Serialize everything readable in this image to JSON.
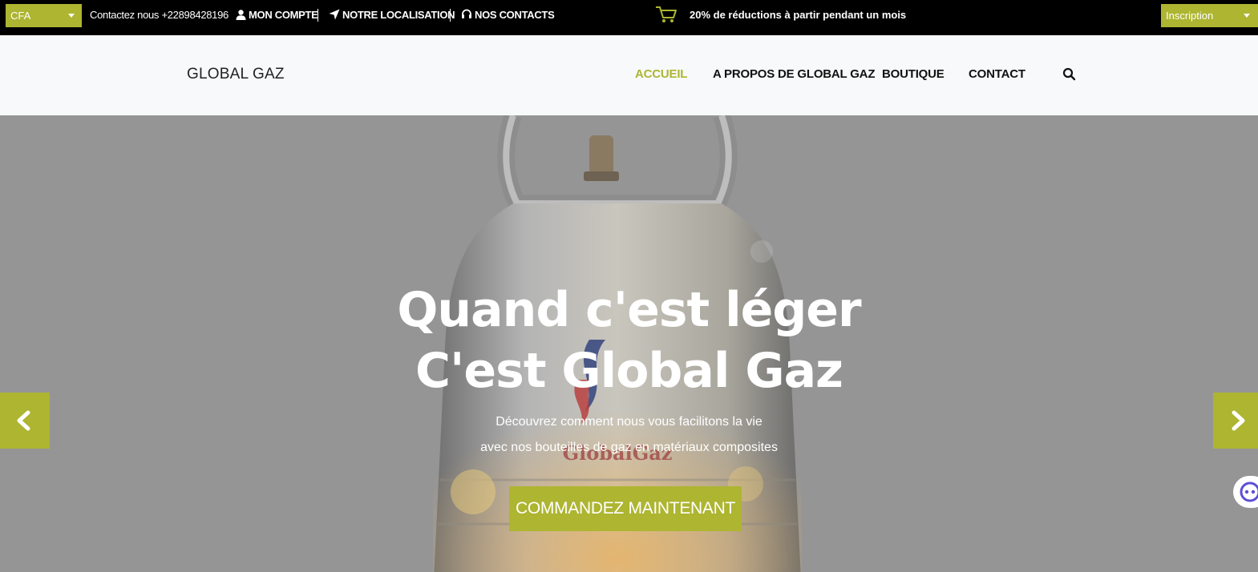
{
  "topbar": {
    "currency": "CFA",
    "phone": "Contactez nous +22898428196",
    "account": "MON COMPTE",
    "location": "NOTRE LOCALISATION",
    "contacts": "NOS CONTACTS",
    "promo": "20% de réductions à partir pendant un mois",
    "signup": "Inscription"
  },
  "header": {
    "logo": "GLOBAL GAZ",
    "nav": [
      "ACCUEIL",
      "A PROPOS DE GLOBAL GAZ",
      "BOUTIQUE",
      "CONTACT"
    ]
  },
  "hero": {
    "title_line1": "Quand c'est léger",
    "title_line2": "C'est Global Gaz",
    "sub_line1": "Découvrez comment nous vous facilitons la vie",
    "sub_line2": "avec nos bouteilles de gaz en matériaux composites",
    "cta": "COMMANDEZ MAINTENANT",
    "bottle_brand": "GlobalGaz"
  },
  "colors": {
    "accent": "#adb531",
    "topbar": "#000000",
    "header": "#f8f9fa",
    "overlay": "#959595"
  },
  "icons": [
    "user-icon",
    "location-arrow-icon",
    "headset-icon",
    "cart-icon",
    "search-icon",
    "chevron-left-icon",
    "chevron-right-icon",
    "chat-icon"
  ]
}
